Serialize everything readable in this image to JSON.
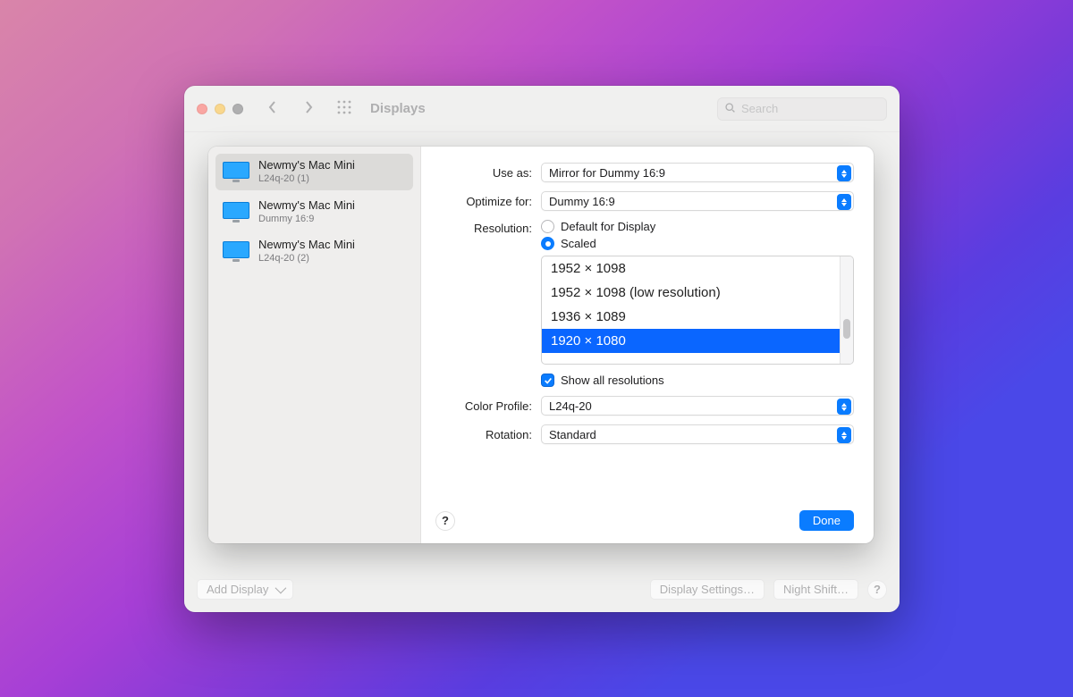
{
  "window": {
    "title": "Displays",
    "search_placeholder": "Search",
    "add_display": "Add Display",
    "display_settings": "Display Settings…",
    "night_shift": "Night Shift…",
    "help": "?"
  },
  "sidebar": {
    "items": [
      {
        "title": "Newmy's Mac Mini",
        "subtitle": "L24q-20 (1)",
        "selected": true
      },
      {
        "title": "Newmy's Mac Mini",
        "subtitle": "Dummy 16:9",
        "selected": false
      },
      {
        "title": "Newmy's Mac Mini",
        "subtitle": "L24q-20 (2)",
        "selected": false
      }
    ]
  },
  "form": {
    "use_as_label": "Use as:",
    "use_as_value": "Mirror for Dummy 16:9",
    "optimize_label": "Optimize for:",
    "optimize_value": "Dummy 16:9",
    "resolution_label": "Resolution:",
    "radio_default": "Default for Display",
    "radio_scaled": "Scaled",
    "resolution_selected": "scaled",
    "resolutions": [
      "1952 × 1098",
      "1952 × 1098 (low resolution)",
      "1936 × 1089",
      "1920 × 1080"
    ],
    "resolution_selected_index": 3,
    "show_all_label": "Show all resolutions",
    "show_all_checked": true,
    "color_profile_label": "Color Profile:",
    "color_profile_value": "L24q-20",
    "rotation_label": "Rotation:",
    "rotation_value": "Standard",
    "help": "?",
    "done": "Done"
  }
}
